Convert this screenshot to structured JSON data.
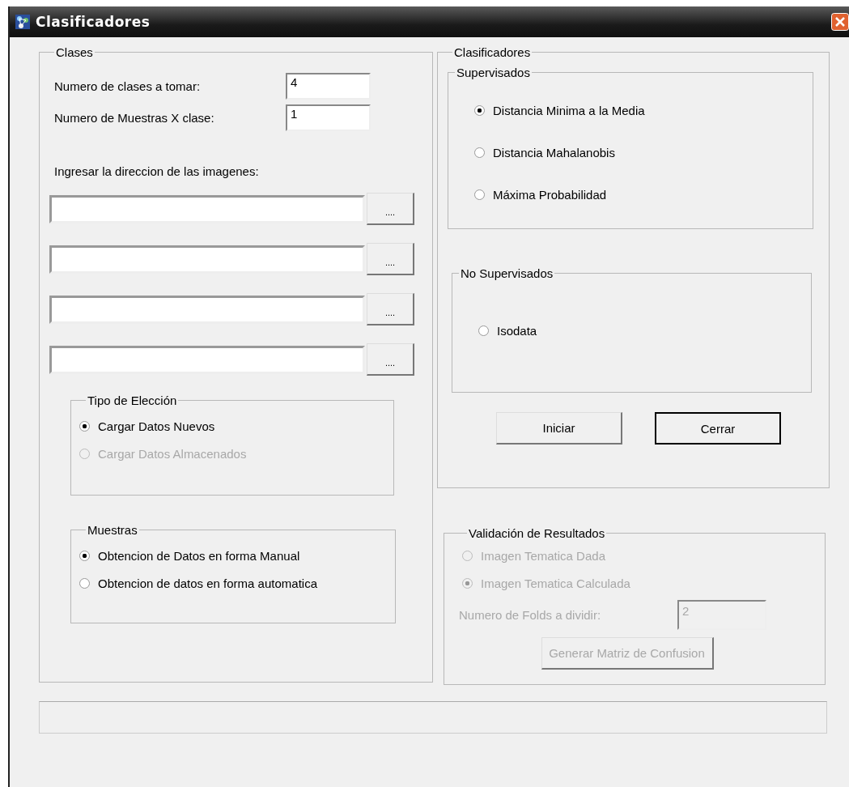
{
  "window": {
    "title": "Clasificadores"
  },
  "clases": {
    "title": "Clases",
    "fields": [
      {
        "label": "Numero de clases a tomar:",
        "value": "4"
      },
      {
        "label": "Numero de Muestras X clase:",
        "value": "1"
      }
    ],
    "paths_label": "Ingresar la direccion de las imagenes:",
    "paths": [
      {
        "browse": "...."
      },
      {
        "browse": "...."
      },
      {
        "browse": "...."
      },
      {
        "browse": "...."
      }
    ],
    "tipo": {
      "title": "Tipo de Elección",
      "options": [
        {
          "label": "Cargar Datos Nuevos",
          "selected": true,
          "disabled": false
        },
        {
          "label": "Cargar Datos Almacenados",
          "selected": false,
          "disabled": true
        }
      ]
    },
    "muestras": {
      "title": "Muestras",
      "options": [
        {
          "label": "Obtencion de Datos en forma Manual",
          "selected": true,
          "disabled": false
        },
        {
          "label": "Obtencion de datos en forma automatica",
          "selected": false,
          "disabled": false
        }
      ]
    }
  },
  "clasificadores": {
    "title": "Clasificadores",
    "supervisados": {
      "title": "Supervisados",
      "options": [
        {
          "label": "Distancia Minima a la Media",
          "selected": true,
          "disabled": false
        },
        {
          "label": "Distancia Mahalanobis",
          "selected": false,
          "disabled": false
        },
        {
          "label": "Máxima Probabilidad",
          "selected": false,
          "disabled": false
        }
      ]
    },
    "no_supervisados": {
      "title": "No Supervisados",
      "options": [
        {
          "label": "Isodata",
          "selected": false,
          "disabled": false
        }
      ]
    },
    "buttons": [
      {
        "label": "Iniciar",
        "default": false
      },
      {
        "label": "Cerrar",
        "default": true
      }
    ]
  },
  "validacion": {
    "title": "Validación de Resultados",
    "disabled": true,
    "options": [
      {
        "label": "Imagen Tematica Dada",
        "selected": false,
        "disabled": true
      },
      {
        "label": "Imagen Tematica Calculada",
        "selected": true,
        "disabled": true
      }
    ],
    "folds": {
      "label": "Numero de Folds a dividir:",
      "value": "2"
    },
    "button": "Generar Matriz de Confusion"
  }
}
